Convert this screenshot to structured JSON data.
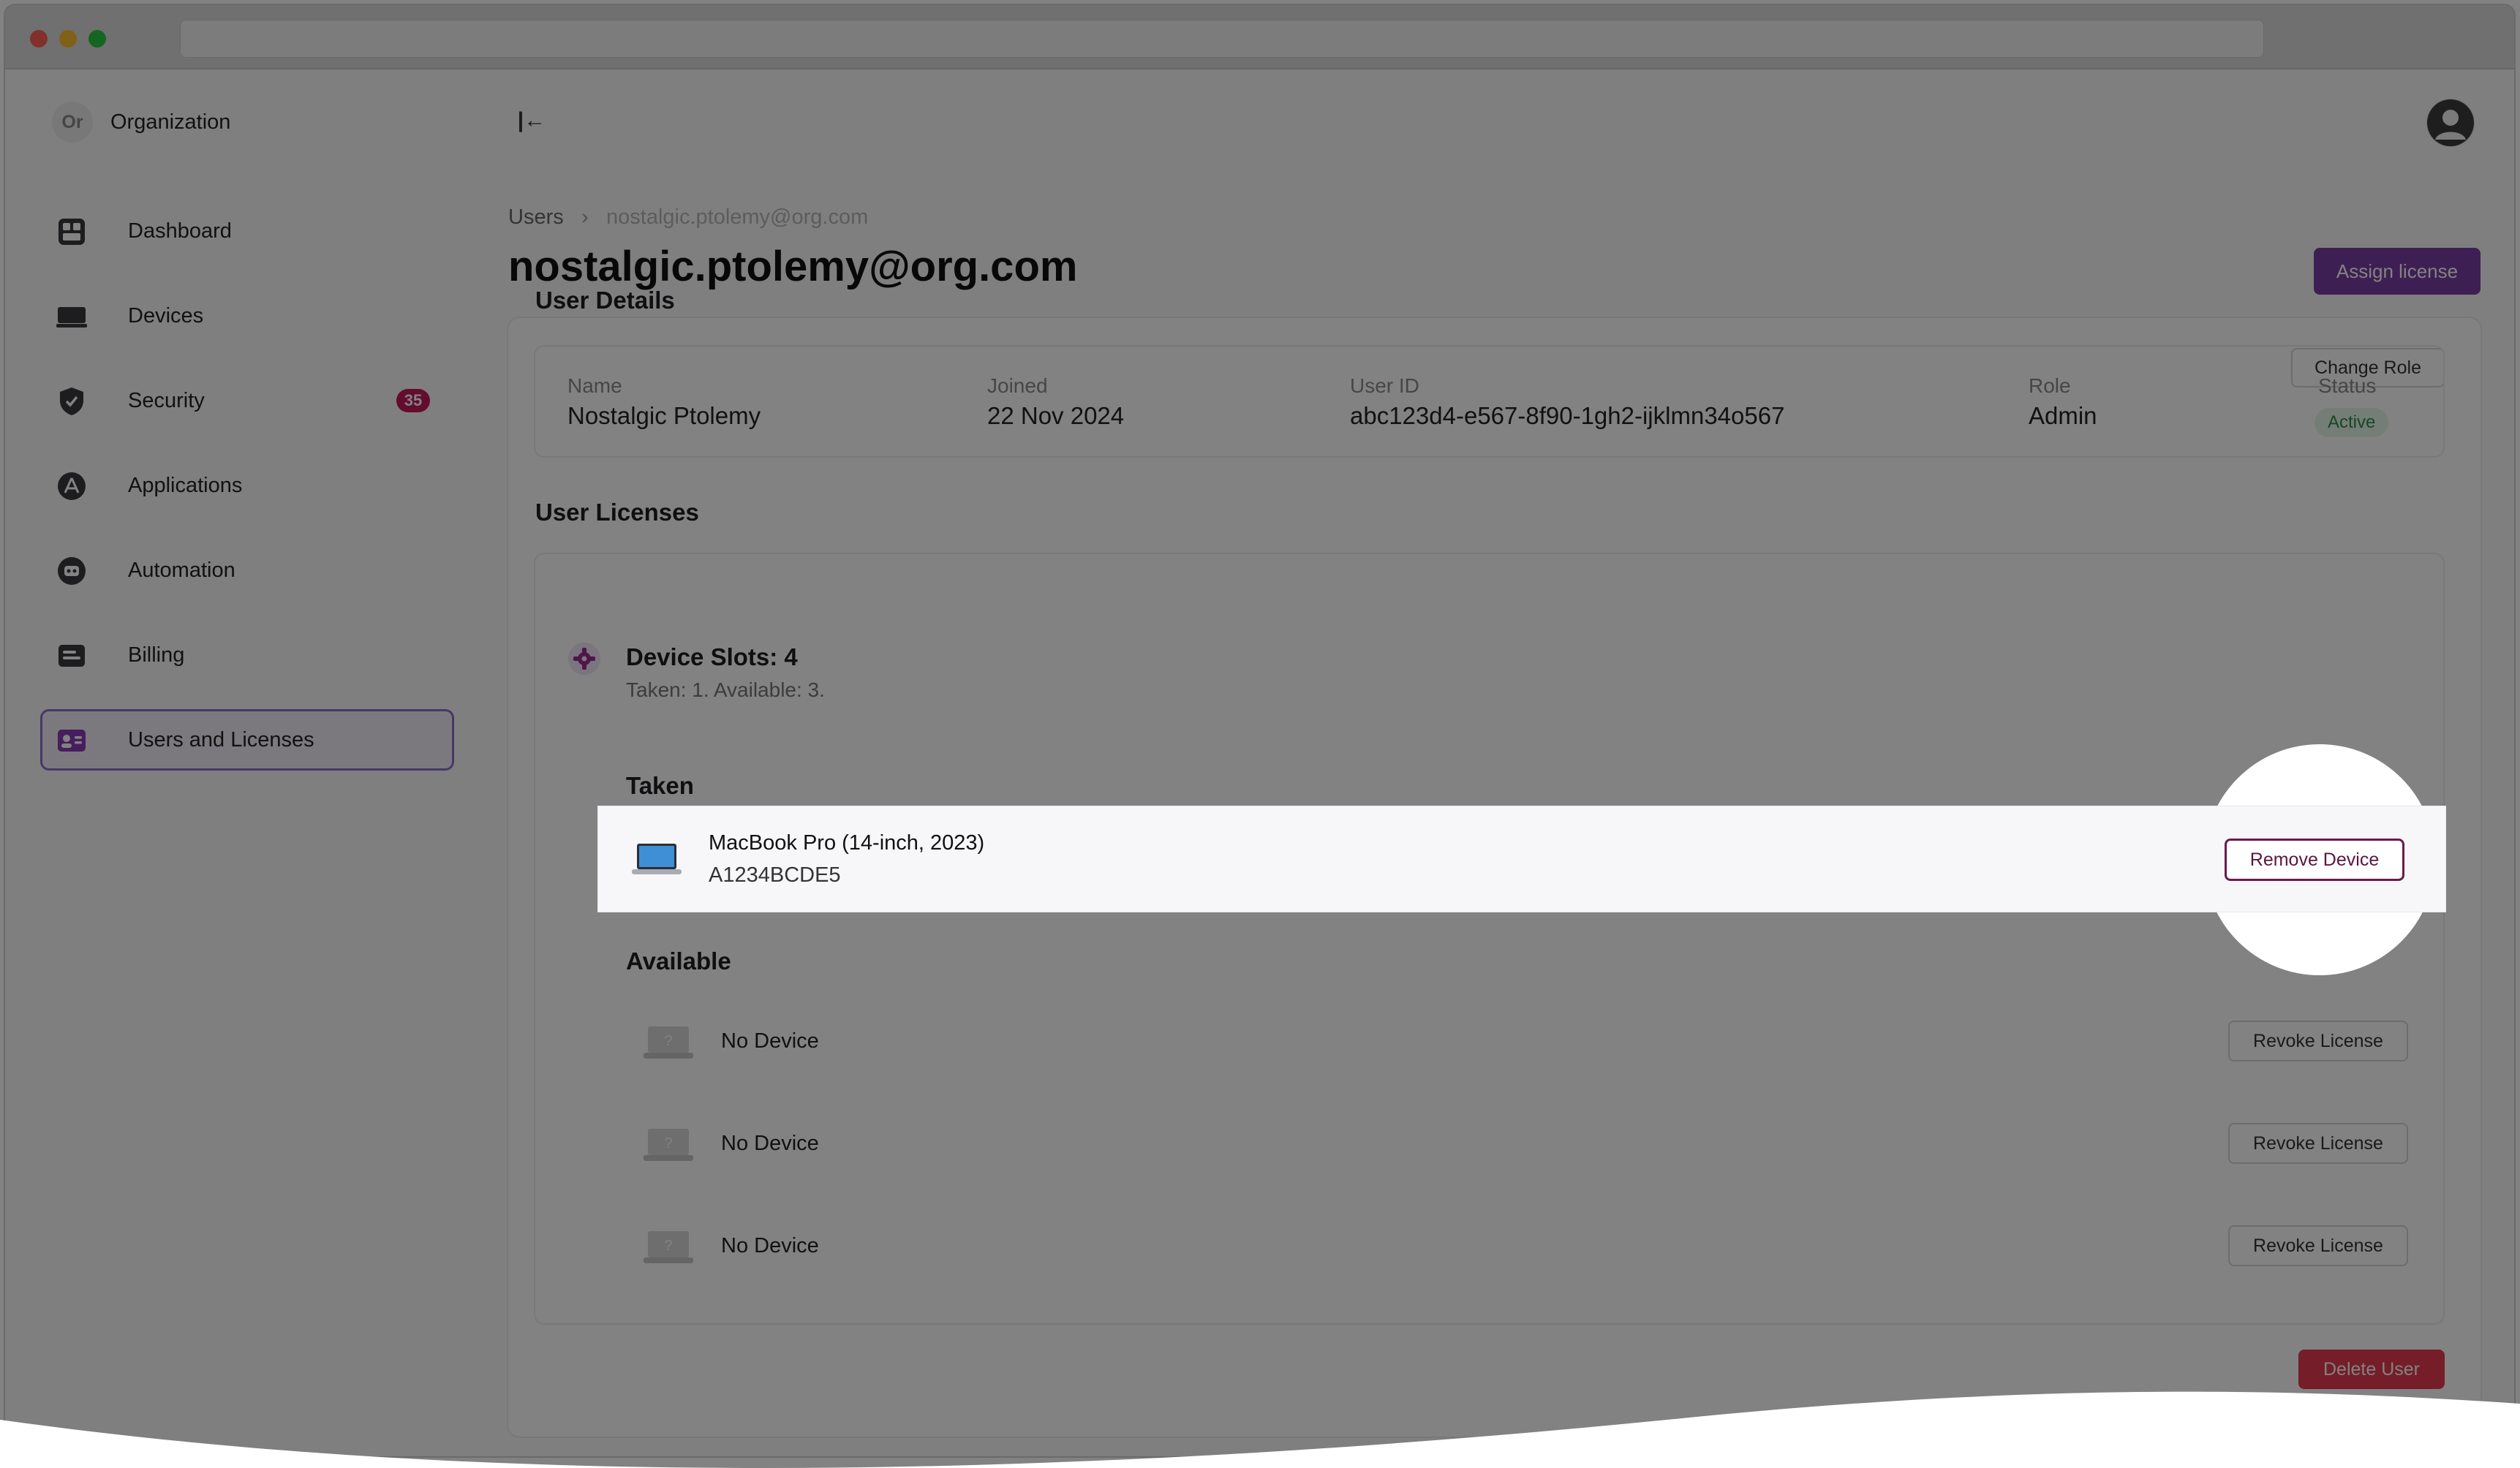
{
  "sidebar": {
    "org_initials": "Or",
    "org_name": "Organization",
    "items": [
      {
        "label": "Dashboard",
        "icon": "dashboard-icon"
      },
      {
        "label": "Devices",
        "icon": "devices-icon"
      },
      {
        "label": "Security",
        "icon": "shield-icon",
        "badge": "35"
      },
      {
        "label": "Applications",
        "icon": "applications-icon"
      },
      {
        "label": "Automation",
        "icon": "automation-icon"
      },
      {
        "label": "Billing",
        "icon": "billing-icon"
      },
      {
        "label": "Users and Licenses",
        "icon": "user-card-icon",
        "active": true
      }
    ]
  },
  "header": {
    "collapse_icon": "collapse-sidebar-icon",
    "avatar_icon": "user-avatar-icon"
  },
  "breadcrumb": {
    "parent": "Users",
    "separator": "›",
    "current": "nostalgic.ptolemy@org.com"
  },
  "page": {
    "title": "nostalgic.ptolemy@org.com",
    "assign_license_label": "Assign license"
  },
  "user_details": {
    "section_title": "User Details",
    "change_role_label": "Change Role",
    "fields": {
      "name_label": "Name",
      "name_value": "Nostalgic Ptolemy",
      "joined_label": "Joined",
      "joined_value": "22 Nov 2024",
      "userid_label": "User ID",
      "userid_value": "abc123d4-e567-8f90-1gh2-ijklmn34o567",
      "role_label": "Role",
      "role_value": "Admin",
      "status_label": "Status",
      "status_value": "Active"
    }
  },
  "licenses": {
    "section_title": "User Licenses",
    "slots_title": "Device Slots: 4",
    "slots_subtitle": "Taken: 1. Available: 3.",
    "taken_title": "Taken",
    "taken": {
      "device_name": "MacBook Pro (14-inch, 2023)",
      "serial": "A1234BCDE5",
      "remove_label": "Remove Device"
    },
    "available_title": "Available",
    "available": [
      {
        "label": "No Device",
        "action": "Revoke License"
      },
      {
        "label": "No Device",
        "action": "Revoke License"
      },
      {
        "label": "No Device",
        "action": "Revoke License"
      }
    ]
  },
  "footer": {
    "delete_user_label": "Delete User"
  },
  "colors": {
    "accent": "#7b3ea3",
    "danger": "#e53950",
    "badge": "#c2185b",
    "status_active": "#2e8b47",
    "overlay": "rgba(0,0,0,0.49)"
  }
}
